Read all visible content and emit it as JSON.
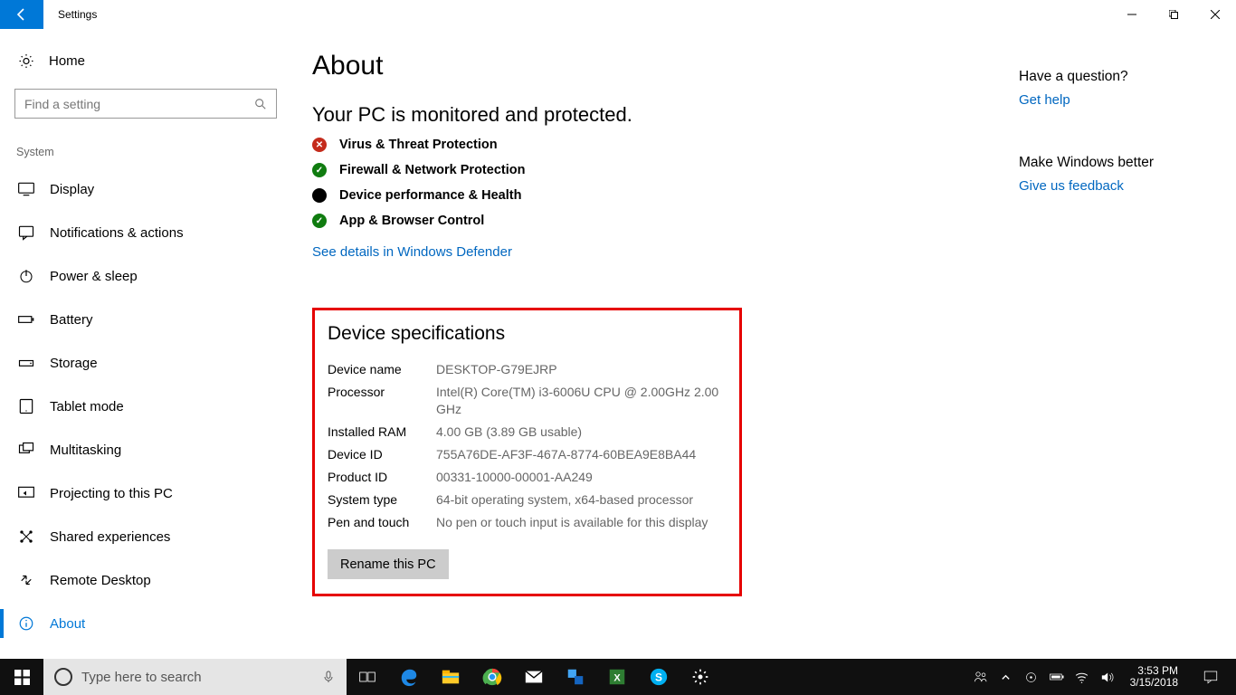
{
  "window": {
    "title": "Settings"
  },
  "sidebar": {
    "home": "Home",
    "search_placeholder": "Find a setting",
    "category": "System",
    "items": [
      {
        "icon": "display-icon",
        "label": "Display"
      },
      {
        "icon": "notifications-icon",
        "label": "Notifications & actions"
      },
      {
        "icon": "power-icon",
        "label": "Power & sleep"
      },
      {
        "icon": "battery-icon",
        "label": "Battery"
      },
      {
        "icon": "storage-icon",
        "label": "Storage"
      },
      {
        "icon": "tablet-icon",
        "label": "Tablet mode"
      },
      {
        "icon": "multitask-icon",
        "label": "Multitasking"
      },
      {
        "icon": "project-icon",
        "label": "Projecting to this PC"
      },
      {
        "icon": "shared-icon",
        "label": "Shared experiences"
      },
      {
        "icon": "remote-icon",
        "label": "Remote Desktop"
      },
      {
        "icon": "about-icon",
        "label": "About",
        "active": true
      }
    ]
  },
  "main": {
    "title": "About",
    "protection_heading": "Your PC is monitored and protected.",
    "statuses": [
      {
        "state": "bad",
        "label": "Virus & Threat Protection"
      },
      {
        "state": "good",
        "label": "Firewall & Network Protection"
      },
      {
        "state": "info",
        "label": "Device performance & Health"
      },
      {
        "state": "good",
        "label": "App & Browser Control"
      }
    ],
    "defender_link": "See details in Windows Defender",
    "spec_heading": "Device specifications",
    "specs": {
      "device_name_label": "Device name",
      "device_name": "DESKTOP-G79EJRP",
      "processor_label": "Processor",
      "processor": "Intel(R) Core(TM) i3-6006U CPU @ 2.00GHz   2.00 GHz",
      "ram_label": "Installed RAM",
      "ram": "4.00 GB (3.89 GB usable)",
      "device_id_label": "Device ID",
      "device_id": "755A76DE-AF3F-467A-8774-60BEA9E8BA44",
      "product_id_label": "Product ID",
      "product_id": "00331-10000-00001-AA249",
      "system_type_label": "System type",
      "system_type": "64-bit operating system, x64-based processor",
      "pen_label": "Pen and touch",
      "pen": "No pen or touch input is available for this display"
    },
    "rename_button": "Rename this PC"
  },
  "rail": {
    "q_heading": "Have a question?",
    "q_link": "Get help",
    "fb_heading": "Make Windows better",
    "fb_link": "Give us feedback"
  },
  "taskbar": {
    "search_placeholder": "Type here to search",
    "time": "3:53 PM",
    "date": "3/15/2018"
  }
}
